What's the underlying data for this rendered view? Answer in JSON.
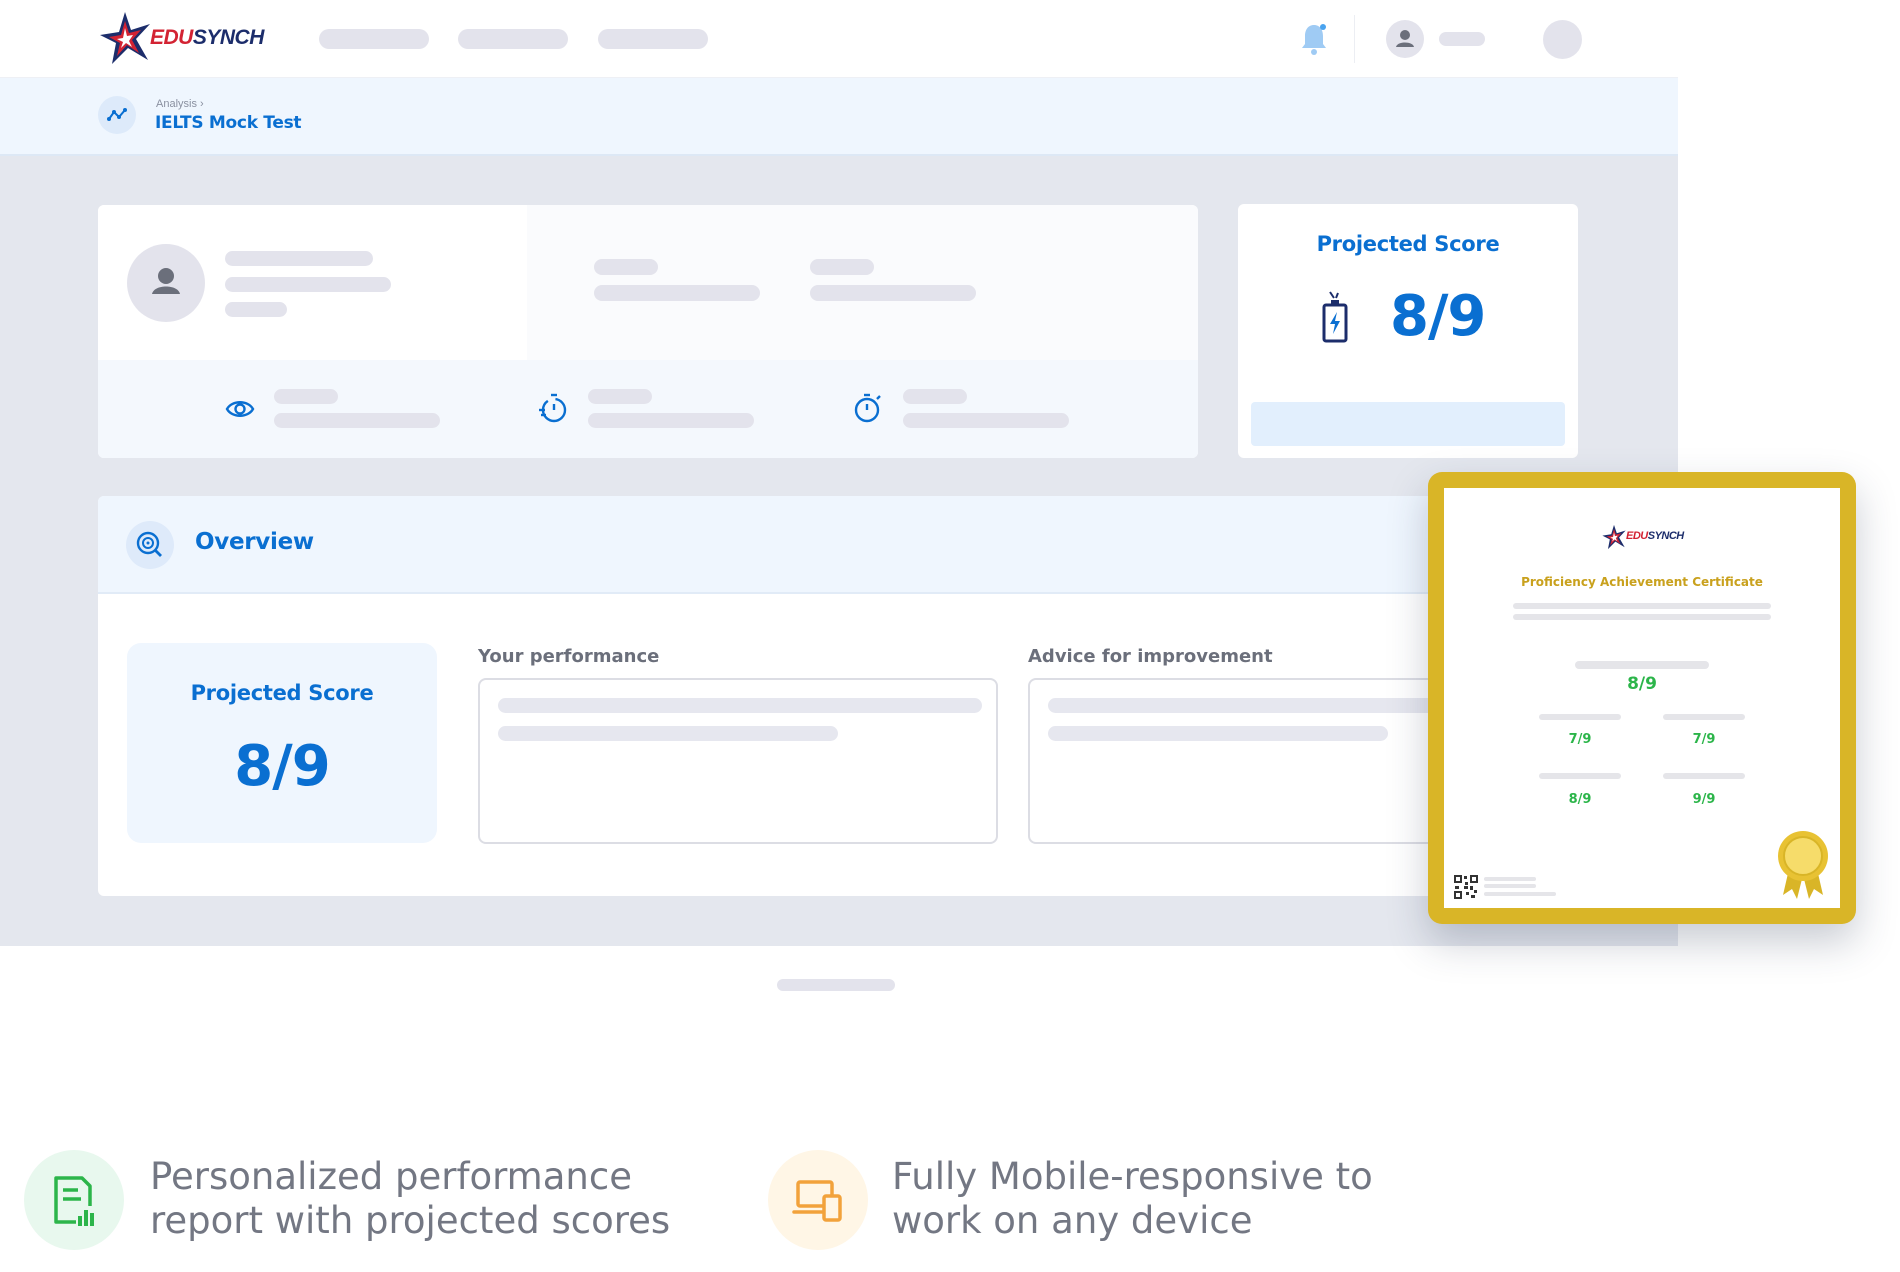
{
  "brand": {
    "name_part1": "EDU",
    "name_part2": "SYNCH",
    "colors": {
      "accent": "#0a6fd1",
      "brand_red": "#d32333",
      "brand_navy": "#1c2d6b",
      "gold": "#d9b527",
      "green": "#2cb54a"
    }
  },
  "header": {
    "icons": [
      "bell-icon",
      "user-avatar-icon"
    ]
  },
  "breadcrumb": {
    "parent": "Analysis",
    "separator": "›",
    "current": "IELTS Mock Test",
    "icon": "analysis-graph-icon"
  },
  "profile_card": {
    "icons": [
      "person-icon",
      "eye-icon",
      "stopwatch-fast-icon",
      "stopwatch-icon"
    ]
  },
  "projected_card": {
    "title": "Projected Score",
    "score": "8/9",
    "icon": "battery-charging-icon"
  },
  "overview": {
    "title": "Overview",
    "icon": "search-target-icon",
    "score_box": {
      "title": "Projected Score",
      "score": "8/9"
    },
    "performance_label": "Your performance",
    "advice_label": "Advice for improvement"
  },
  "certificate": {
    "brand_part1": "EDU",
    "brand_part2": "SYNCH",
    "title": "Proficiency Achievement Certificate",
    "overall": "8/9",
    "bands": [
      "7/9",
      "7/9",
      "8/9",
      "9/9"
    ],
    "icons": [
      "qr-code-icon",
      "award-seal-icon"
    ]
  },
  "features": [
    {
      "icon": "report-chart-icon",
      "line1": "Personalized performance",
      "line2": "report with projected scores",
      "icon_bg": "#e8f8ee",
      "icon_color": "#2cb54a"
    },
    {
      "icon": "devices-icon",
      "line1": "Fully Mobile-responsive to",
      "line2": "work on any device",
      "icon_bg": "#fff6e6",
      "icon_color": "#f2a23b"
    }
  ]
}
